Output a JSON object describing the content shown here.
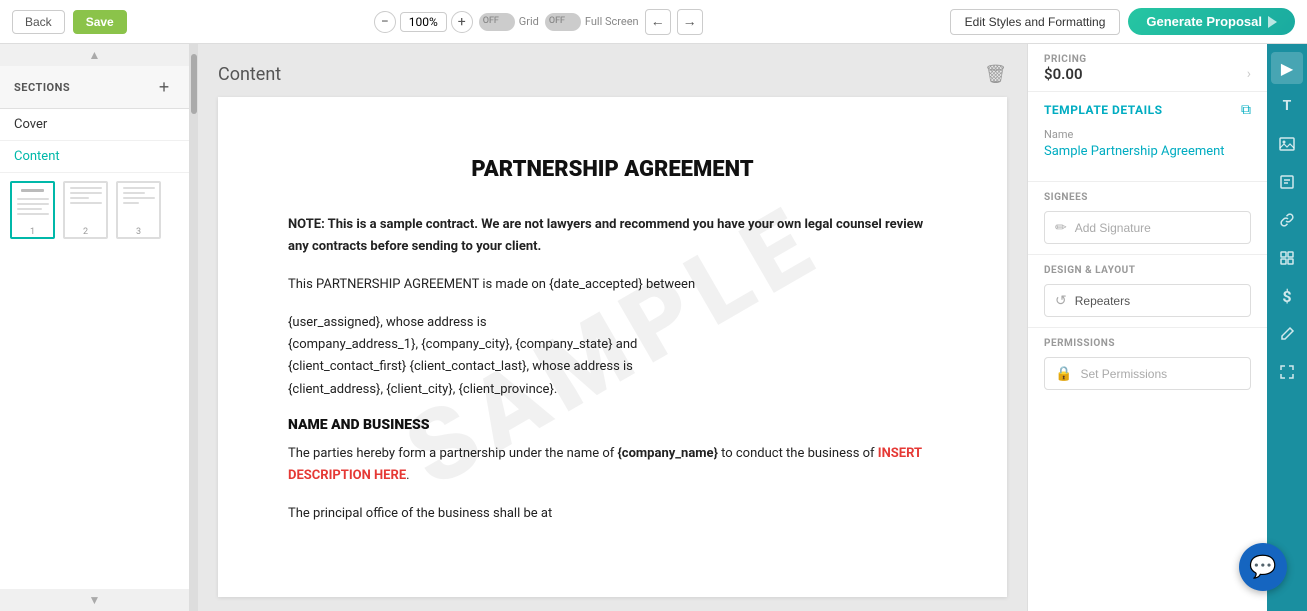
{
  "toolbar": {
    "back_label": "Back",
    "save_label": "Save",
    "zoom_value": "100%",
    "zoom_minus": "−",
    "zoom_plus": "+",
    "grid_toggle": "OFF",
    "grid_label": "Grid",
    "fullscreen_toggle": "OFF",
    "fullscreen_label": "Full Screen",
    "edit_styles_label": "Edit Styles and Formatting",
    "generate_label": "Generate Proposal"
  },
  "left_sidebar": {
    "sections_title": "SECTIONS",
    "add_icon": "+",
    "items": [
      {
        "label": "Cover",
        "active": false
      },
      {
        "label": "Content",
        "active": true
      }
    ],
    "pages": [
      {
        "num": "1",
        "active": true
      },
      {
        "num": "2",
        "active": false
      },
      {
        "num": "3",
        "active": false
      }
    ]
  },
  "content": {
    "title": "Content",
    "doc_heading": "PARTNERSHIP AGREEMENT",
    "note_text": "NOTE: This is a sample contract. We are not lawyers and recommend you have your own legal counsel review any contracts before sending to your client.",
    "intro_text": "This PARTNERSHIP AGREEMENT is made on {date_accepted} between",
    "party_text": "{user_assigned}, whose address is\n{company_address_1}, {company_city}, {company_state} and\n{client_contact_first} {client_contact_last}, whose address is\n{client_address}, {client_city}, {client_province}.",
    "section_heading": "NAME AND BUSINESS",
    "business_text": "The parties hereby form a partnership under the name of {company_name} to conduct the business of INSERT DESCRIPTION HERE.",
    "principal_text": "The principal office of the business shall be at",
    "cta_text": "INSERT DESCRIPTION HERE",
    "watermark": "SAMPLE"
  },
  "right_sidebar": {
    "pricing_label": "PRICING",
    "pricing_value": "$0.00",
    "template_details_title": "TEMPLATE DETAILS",
    "name_label": "Name",
    "name_value": "Sample Partnership Agreement",
    "signees_label": "SIGNEES",
    "add_signature_label": "Add Signature",
    "design_layout_label": "DESIGN & LAYOUT",
    "repeaters_label": "Repeaters",
    "permissions_label": "PERMISSIONS",
    "set_permissions_label": "Set Permissions",
    "icons": [
      {
        "name": "arrow-icon",
        "symbol": "▶",
        "active": true
      },
      {
        "name": "text-icon",
        "symbol": "T",
        "active": false
      },
      {
        "name": "image-icon",
        "symbol": "🖼",
        "active": false
      },
      {
        "name": "form-icon",
        "symbol": "⊞",
        "active": false
      },
      {
        "name": "link-icon",
        "symbol": "⚡",
        "active": false
      },
      {
        "name": "grid-icon",
        "symbol": "⊟",
        "active": false
      },
      {
        "name": "dollar-icon",
        "symbol": "$",
        "active": false
      },
      {
        "name": "pen-icon",
        "symbol": "✏",
        "active": false
      },
      {
        "name": "expand-icon",
        "symbol": "⤡",
        "active": false
      }
    ]
  },
  "chat": {
    "icon": "💬"
  }
}
